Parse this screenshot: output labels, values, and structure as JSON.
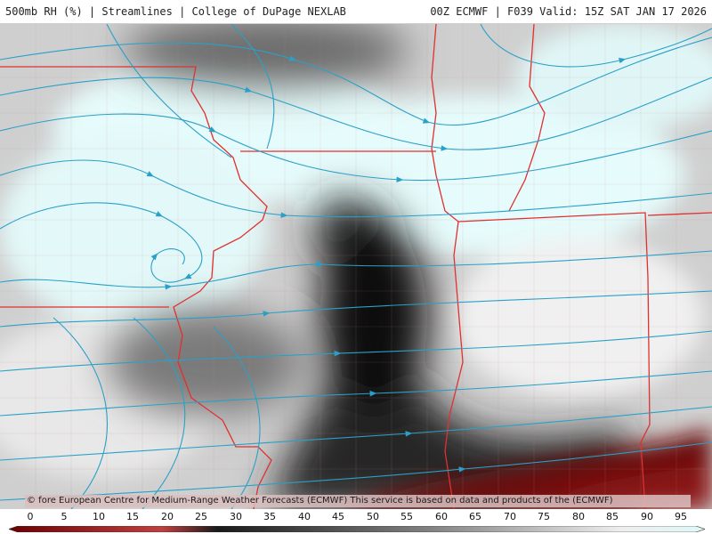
{
  "header": {
    "left_title": "500mb RH (%) | Streamlines | College of DuPage NEXLAB",
    "right_title": "00Z ECMWF | F039 Valid: 15Z SAT JAN 17 2026"
  },
  "map": {
    "attribution": "© fore European Centre for Medium-Range Weather Forecasts (ECMWF)  This service is based on data and products of the (ECMWF)",
    "streamline_color": "#2aa0c8",
    "border_color": "#e03030",
    "icons": [
      "streamline-arrow-icon"
    ]
  },
  "legend": {
    "ticks": [
      "0",
      "5",
      "10",
      "15",
      "20",
      "25",
      "30",
      "35",
      "40",
      "45",
      "50",
      "55",
      "60",
      "65",
      "70",
      "75",
      "80",
      "85",
      "90",
      "95"
    ],
    "colors": {
      "low": "#6b0000",
      "mid_low": "#1a1a1a",
      "mid": "#7a7a7a",
      "high": "#e8e8e8",
      "saturated": "#dff7f7"
    }
  }
}
